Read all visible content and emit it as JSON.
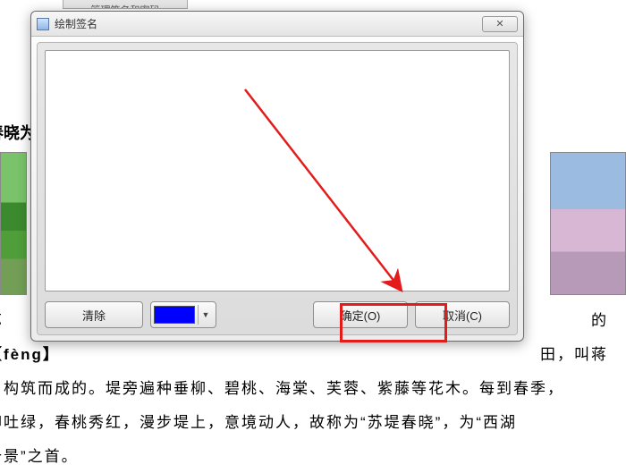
{
  "background": {
    "tab_stub": "管理签名和密码",
    "heading": "苏堤春晓为西湖十景之首",
    "p1_left": "苏",
    "p1_right": "的",
    "p2_left": "【fèng】",
    "p2_right": "田，叫蒋",
    "p3": "）构筑而成的。堤旁遍种垂柳、碧桃、海棠、芙蓉、紫藤等花木。每到春季，",
    "p4": "柳吐绿，春桃秀红，漫步堤上，意境动人，故称为“苏堤春晓”，为“西湖",
    "p5": "十景”之首。"
  },
  "dialog": {
    "title": "绘制签名",
    "close_glyph": "✕",
    "buttons": {
      "clear": "清除",
      "ok": "确定(O)",
      "cancel": "取消(C)"
    },
    "color": "#0000ff",
    "caret": "▼"
  }
}
